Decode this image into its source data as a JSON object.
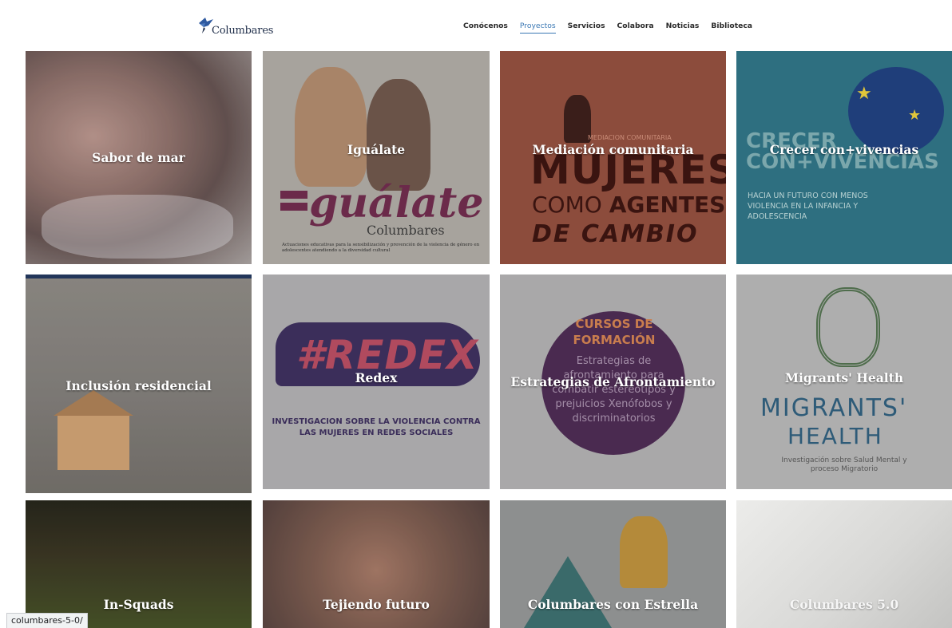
{
  "brand": {
    "name": "Columbares",
    "logo_color": "#2f5aa0"
  },
  "nav": {
    "items": [
      {
        "label": "Conócenos",
        "active": false
      },
      {
        "label": "Proyectos",
        "active": true
      },
      {
        "label": "Servicios",
        "active": false
      },
      {
        "label": "Colabora",
        "active": false
      },
      {
        "label": "Noticias",
        "active": false
      },
      {
        "label": "Biblioteca",
        "active": false
      }
    ],
    "active_color": "#3b78b4"
  },
  "projects": [
    {
      "title": "Sabor de mar",
      "bg": "#9a8a86"
    },
    {
      "title": "Iguálate",
      "bg": "#b0aca6",
      "art": {
        "word": "guálate",
        "brand": "Columbares",
        "caption": "Actuaciones educativas para la sensibilización y prevención de la violencia de género en adolescentes atendiendo a la diversidad cultural"
      }
    },
    {
      "title": "Mediación comunitaria",
      "bg": "#8c4c3c",
      "art": {
        "small": "MEDIACION COMUNITARIA",
        "line1": "MUJERES",
        "line2a": "COMO ",
        "line2b": "AGENTES",
        "line3": "DE CAMBIO"
      }
    },
    {
      "title": "Crecer con+vivencias",
      "bg": "#2e6f80",
      "art": {
        "line1": "CRECER",
        "line2": "CON+VIVENCIAS",
        "sub": "HACIA UN FUTURO CON MENOS VIOLENCIA EN LA INFANCIA Y ADOLESCENCIA"
      }
    },
    {
      "title": "Inclusión residencial",
      "bg": "#8e8a86"
    },
    {
      "title": "Redex",
      "bg": "#a8a7a9",
      "art": {
        "tag": "#REDEX",
        "sub": "INVESTIGACION SOBRE LA VIOLENCIA CONTRA LAS MUJERES EN REDES SOCIALES"
      }
    },
    {
      "title": "Estrategias de Afrontamiento",
      "bg": "#a9a8a9",
      "art": {
        "head": "CURSOS DE FORMACIÓN",
        "body": "Estrategias de afrontamiento para combatir estereotipos y prejuicios Xenófobos y discriminatorios"
      }
    },
    {
      "title": "Migrants' Health",
      "bg": "#aeaeae",
      "art": {
        "word1": "MIGRANTS'",
        "word2": "HEALTH",
        "sub": "Investigación sobre Salud Mental y proceso Migratorio"
      }
    },
    {
      "title": "In-Squads",
      "bg": "#3f3a26"
    },
    {
      "title": "Tejiendo futuro",
      "bg": "#8a6658"
    },
    {
      "title": "Columbares con Estrella",
      "bg": "#8d8f8f"
    },
    {
      "title": "Columbares 5.0",
      "bg": "#d8d8d6"
    }
  ],
  "status_bar": {
    "url": "columbares-5-0/"
  }
}
